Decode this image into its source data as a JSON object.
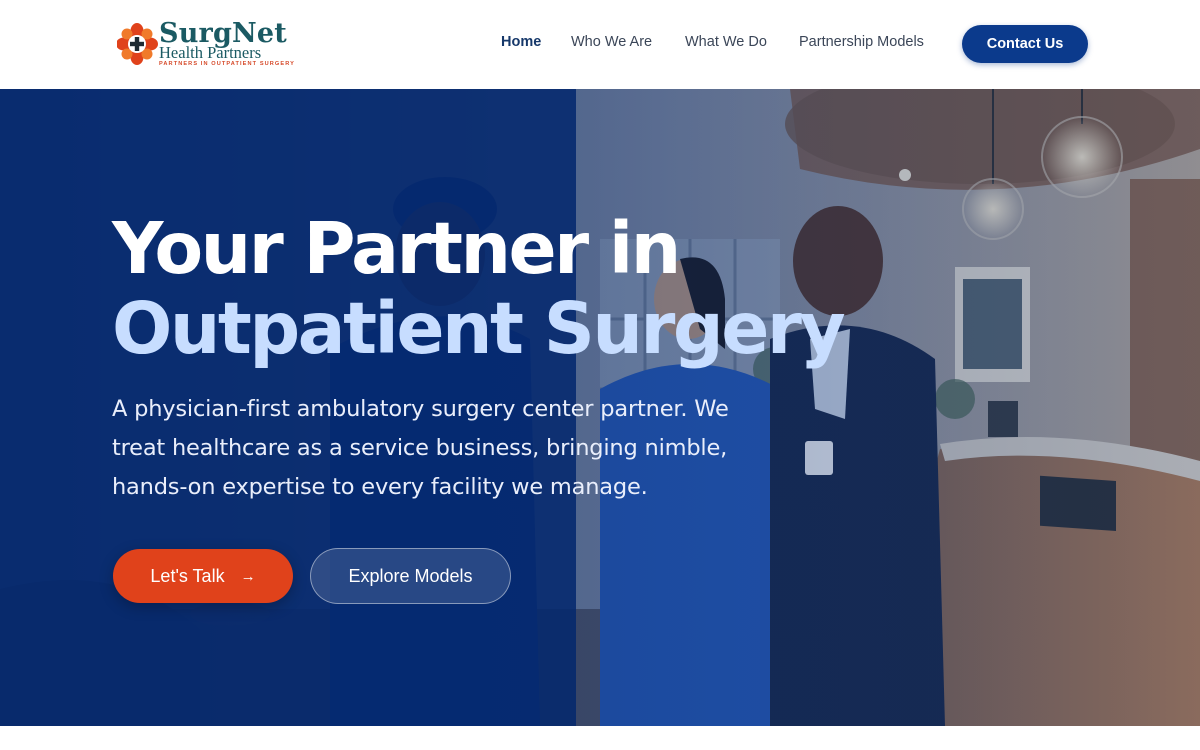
{
  "brand": {
    "name_main": "SurgNet",
    "name_sub": "Health Partners",
    "tagline": "PARTNERS IN OUTPATIENT SURGERY",
    "logo_icon": "cross-flower-icon",
    "primary_color": "#0b3a8c",
    "accent_color": "#e0421b",
    "logo_text_color": "#1b5a63"
  },
  "nav": {
    "items": [
      {
        "label": "Home",
        "active": true
      },
      {
        "label": "Who We Are",
        "active": false
      },
      {
        "label": "What We Do",
        "active": false
      },
      {
        "label": "Partnership Models",
        "active": false
      }
    ],
    "cta_label": "Contact Us"
  },
  "hero": {
    "headline_line1": "Your Partner in",
    "headline_line2": "Outpatient Surgery",
    "description_lines": [
      "A physician-first ambulatory surgery center partner. We",
      "treat healthcare as a service business, bringing nimble,",
      "hands-on expertise to every facility we manage."
    ],
    "primary_button": {
      "label": "Let's Talk",
      "icon": "arrow-right-icon"
    },
    "secondary_button": {
      "label": "Explore Models"
    },
    "background_image": "medical-staff-in-clinic-lobby"
  }
}
